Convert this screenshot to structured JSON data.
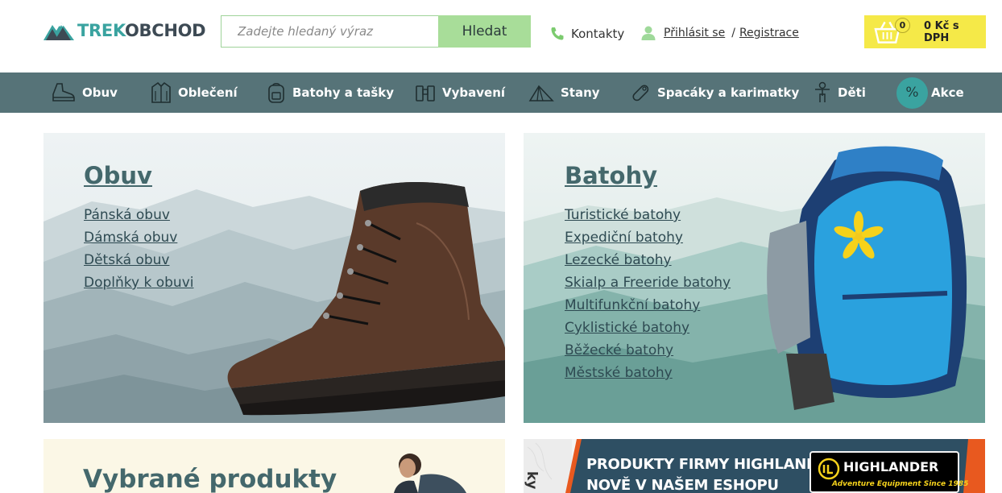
{
  "header": {
    "logo": {
      "part1": "TREK",
      "part2": "OBCHOD"
    },
    "search": {
      "placeholder": "Zadejte hledaný výraz",
      "button_label": "Hledat"
    },
    "contacts_label": "Kontakty",
    "login_label": "Přihlásit se",
    "separator": "/",
    "register_label": "Registrace",
    "cart": {
      "count": "0",
      "price": "0 Kč s DPH"
    }
  },
  "nav": {
    "items": [
      {
        "label": "Obuv",
        "icon": "boot-icon"
      },
      {
        "label": "Oblečení",
        "icon": "jacket-icon"
      },
      {
        "label": "Batohy a tašky",
        "icon": "backpack-icon"
      },
      {
        "label": "Vybavení",
        "icon": "binoculars-icon"
      },
      {
        "label": "Stany",
        "icon": "tent-icon"
      },
      {
        "label": "Spacáky a karimatky",
        "icon": "sleeping-bag-icon"
      },
      {
        "label": "Děti",
        "icon": "child-icon"
      },
      {
        "label": "Akce",
        "icon": "percent-badge",
        "badge": "%"
      }
    ]
  },
  "banners": {
    "obuv": {
      "title": "Obuv",
      "links": [
        "Pánská obuv",
        "Dámská obuv",
        "Dětská obuv",
        "Doplňky k obuvi"
      ]
    },
    "batohy": {
      "title": "Batohy",
      "links": [
        "Turistické batohy",
        "Expediční batohy",
        "Lezecké batohy",
        "Skialp a Freeride batohy",
        "Multifunkční batohy",
        "Cyklistické batohy",
        "Běžecké batohy",
        "Městské batohy"
      ]
    },
    "vybrane": {
      "title": "Vybrané produkty"
    },
    "highlander": {
      "line1": "PRODUKTY FIRMY HIGHLANDER",
      "line2": "NOVĚ V NAŠEM ESHOPU",
      "brand": "HIGHLANDER",
      "tagline": "Adventure Equipment Since 1985",
      "side_text": "ky"
    }
  },
  "colors": {
    "accent_teal": "#3aa3a0",
    "nav_bg": "#567378",
    "search_button": "#a8dd99",
    "cart_bg": "#f5e948",
    "banner_title": "#44686c"
  }
}
